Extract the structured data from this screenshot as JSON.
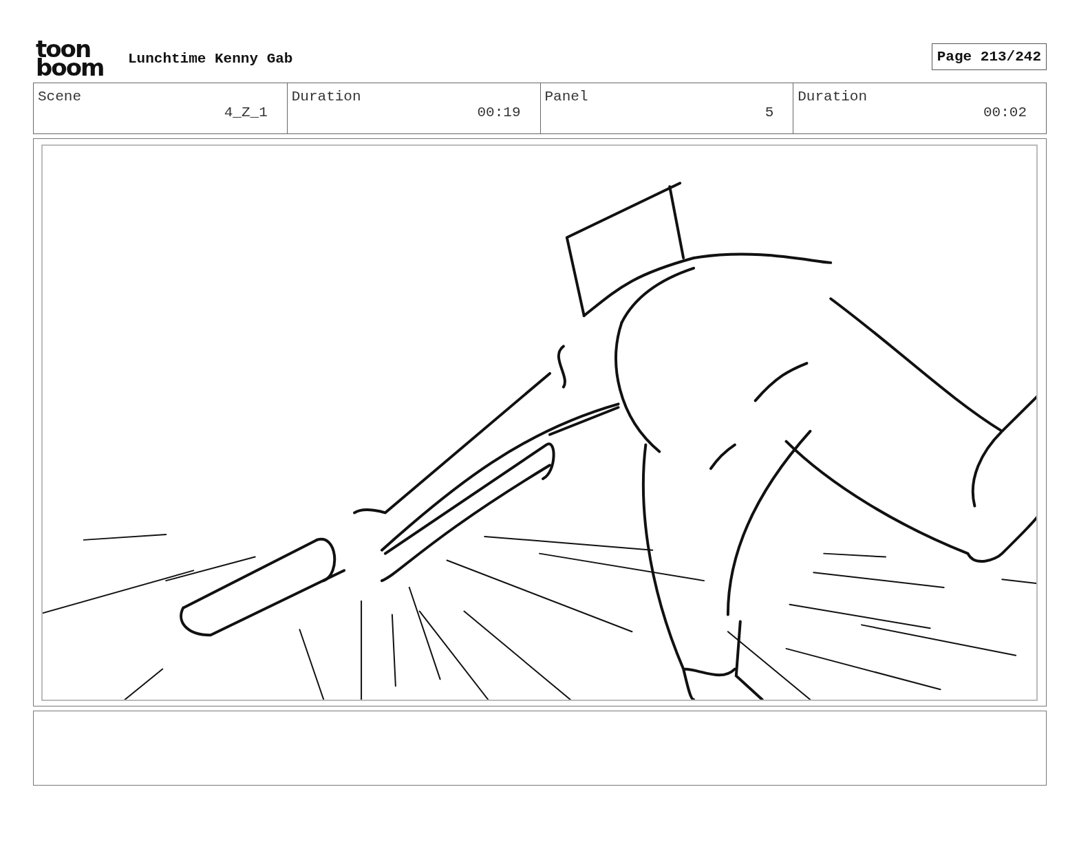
{
  "header": {
    "logo": [
      "toon",
      "boom"
    ],
    "title": "Lunchtime Kenny Gab",
    "page": "Page 213/242"
  },
  "fields": [
    {
      "label": "Scene",
      "value": "4_Z_1"
    },
    {
      "label": "Duration",
      "value": "00:19"
    },
    {
      "label": "Panel",
      "value": "5"
    },
    {
      "label": "Duration",
      "value": "00:02"
    }
  ]
}
